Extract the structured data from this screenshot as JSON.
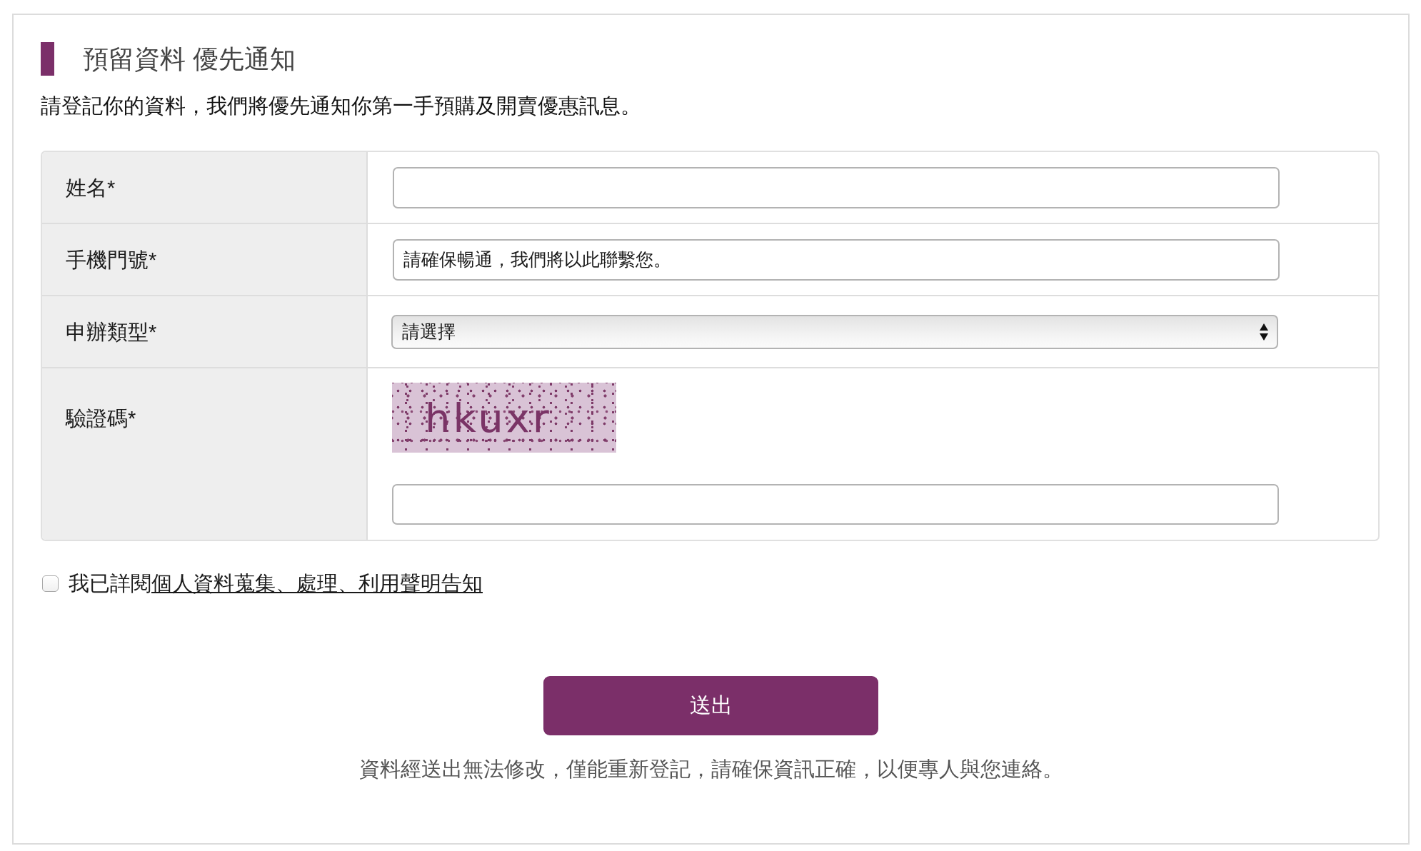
{
  "heading": {
    "title": "預留資料 優先通知",
    "subtitle": "請登記你的資料，我們將優先通知你第一手預購及開賣優惠訊息。"
  },
  "form": {
    "fields": [
      {
        "kind": "text",
        "label": "姓名*"
      },
      {
        "kind": "text",
        "label": "手機門號*",
        "placeholder": "請確保暢通，我們將以此聯繫您。"
      },
      {
        "kind": "select",
        "label": "申辦類型*",
        "value": "請選擇"
      },
      {
        "kind": "captcha",
        "label": "驗證碼*",
        "captcha_text": "hkuxr"
      }
    ]
  },
  "consent": {
    "checked": false,
    "text": "我已詳閱",
    "link": "個人資料蒐集、處理、利用聲明告知"
  },
  "submit_button": "送出",
  "note": "資料經送出無法修改，僅能重新登記，請確保資訊正確，以便專人與您連絡。"
}
